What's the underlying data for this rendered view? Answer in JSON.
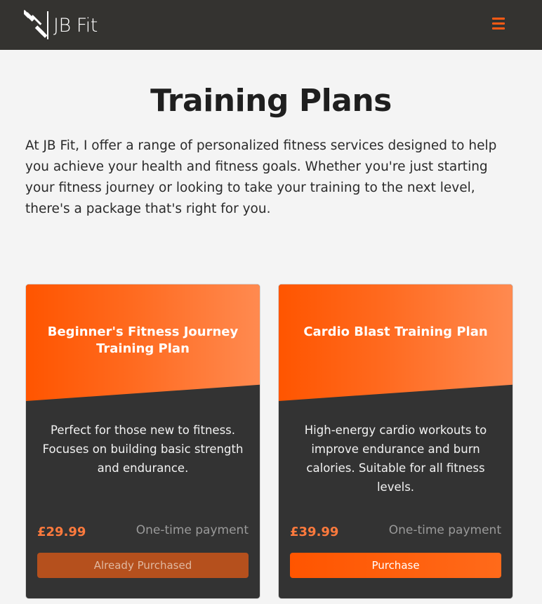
{
  "header": {
    "logo_text": "JB Fit",
    "menu_icon": "hamburger-icon",
    "accent_color": "#ff5a14",
    "background_color": "#343330"
  },
  "main": {
    "title": "Training Plans",
    "intro": "At JB Fit, I offer a range of personalized fitness services designed to help you achieve your health and fitness goals. Whether you're just starting your fitness journey or looking to take your training to the next level, there's a package that's right for you."
  },
  "plans": [
    {
      "title": "Beginner's Fitness Journey Training Plan",
      "description": "Perfect for those new to fitness. Focuses on building basic strength and endurance.",
      "price": "£29.99",
      "payment_type": "One-time payment",
      "button_label": "Already Purchased",
      "button_state": "disabled"
    },
    {
      "title": "Cardio Blast Training Plan",
      "description": "High-energy cardio workouts to improve endurance and burn calories. Suitable for all fitness levels.",
      "price": "£39.99",
      "payment_type": "One-time payment",
      "button_label": "Purchase",
      "button_state": "active"
    }
  ]
}
